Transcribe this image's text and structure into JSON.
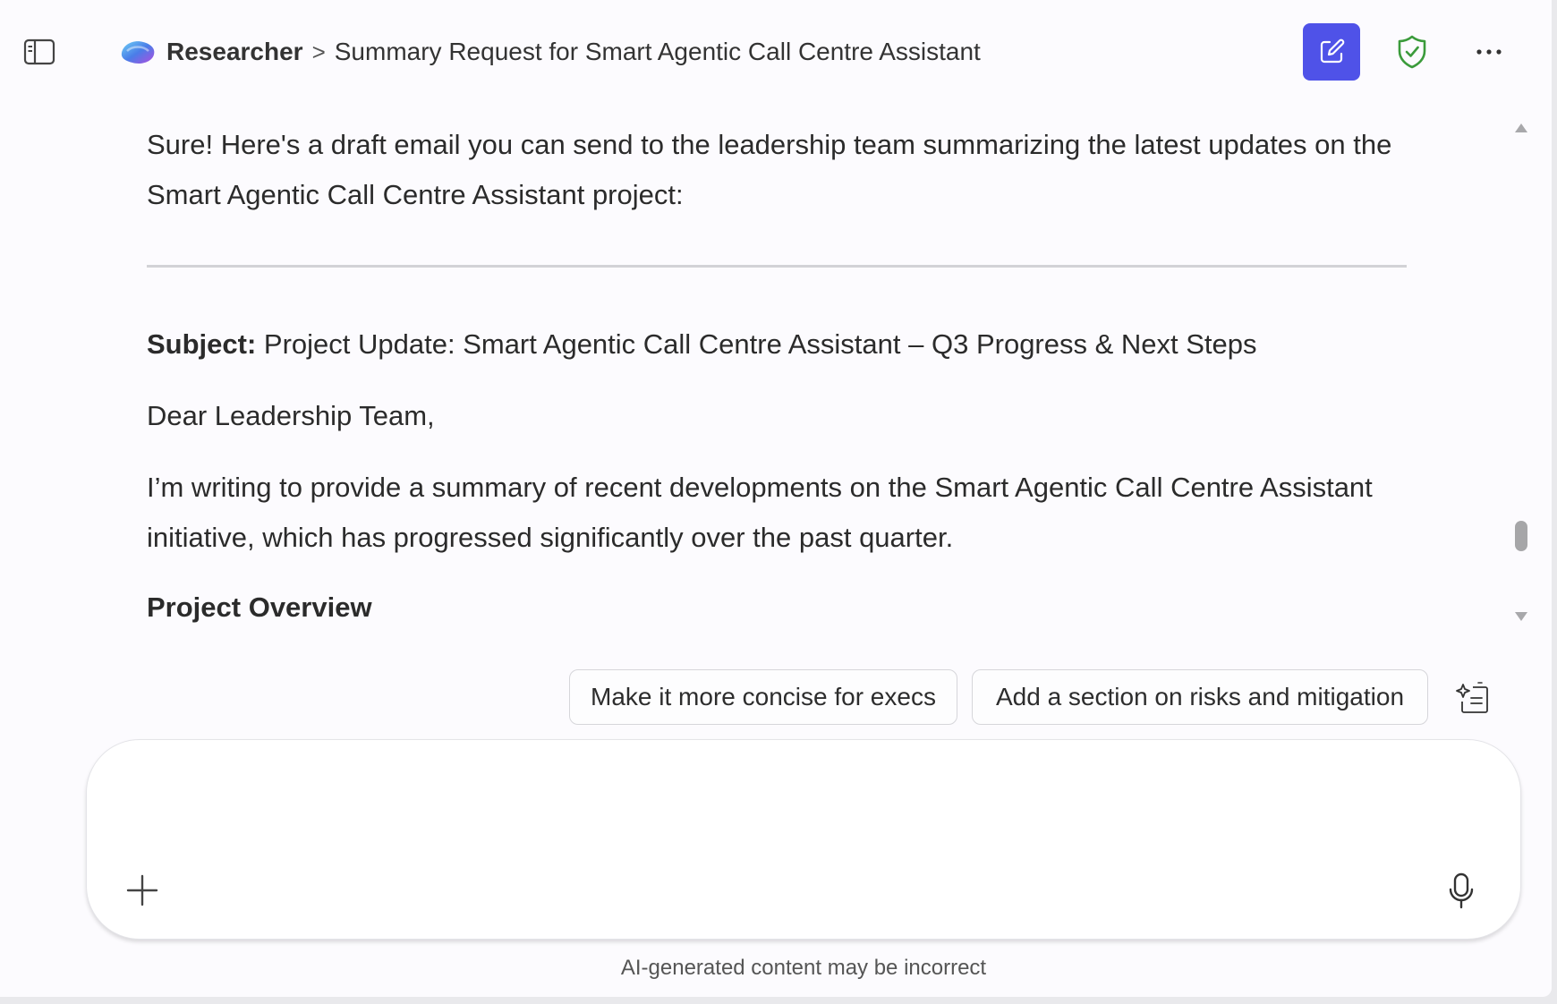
{
  "header": {
    "breadcrumb_root": "Researcher",
    "breadcrumb_separator": ">",
    "breadcrumb_current": "Summary Request for Smart Agentic Call Centre Assistant",
    "accent_color": "#4f52e8",
    "shield_color": "#3b9b3b",
    "icons": [
      "sidebar-toggle-icon",
      "researcher-logo",
      "new-chat-icon",
      "shield-check-icon",
      "more-options-icon"
    ]
  },
  "message": {
    "intro": "Sure! Here's a draft email you can send to the leadership team summarizing the latest updates on the Smart Agentic Call Centre Assistant project:",
    "subject_label": "Subject:",
    "subject_text": " Project Update: Smart Agentic Call Centre Assistant – Q3 Progress & Next Steps",
    "greeting": "Dear Leadership Team,",
    "body": "I’m writing to provide a summary of recent developments on the Smart Agentic Call Centre Assistant initiative, which has progressed significantly over the past quarter.",
    "section_heading": "Project Overview"
  },
  "suggestions": [
    "Make it more concise for execs",
    "Add a section on risks and mitigation"
  ],
  "composer": {
    "placeholder": "",
    "value": ""
  },
  "footer": {
    "disclaimer": "AI-generated content may be incorrect"
  }
}
